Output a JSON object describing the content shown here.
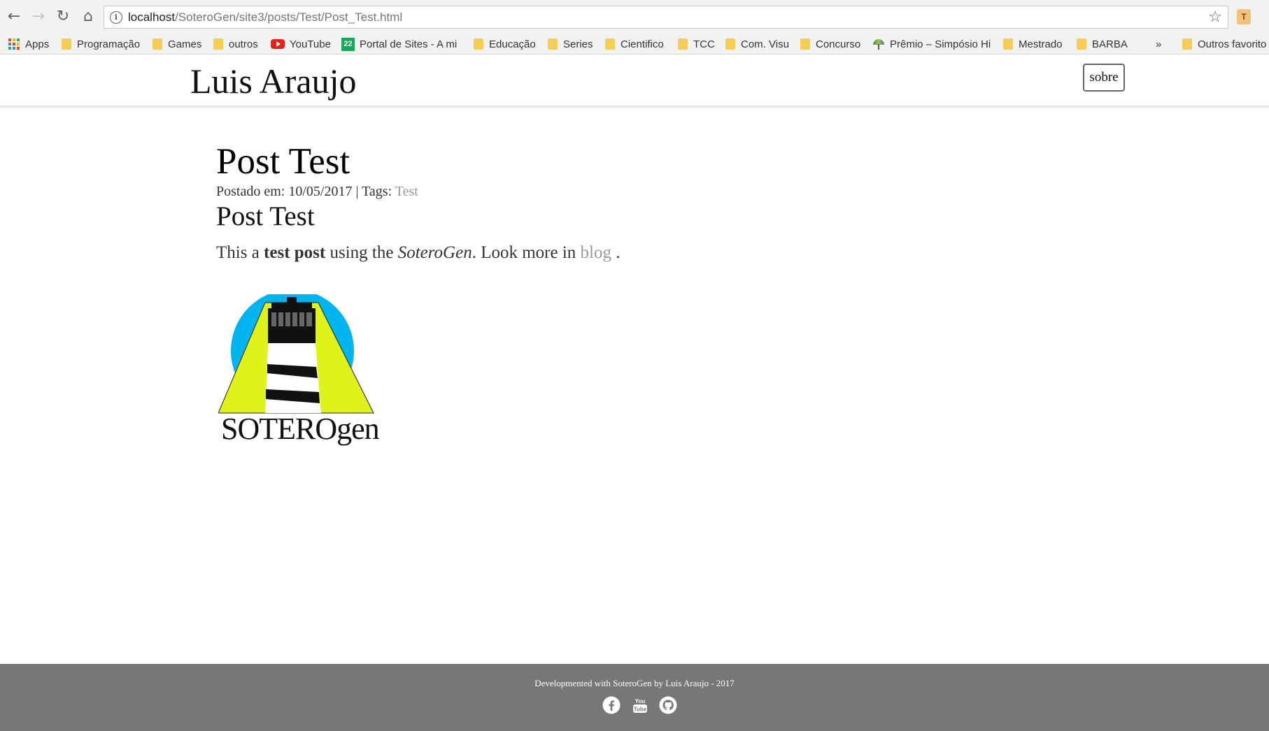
{
  "browser": {
    "url_host": "localhost",
    "url_path": "/SoteroGen/site3/posts/Test/Post_Test.html",
    "bookmarks": {
      "apps": "Apps",
      "programacao": "Programação",
      "games": "Games",
      "outros": "outros",
      "youtube": "YouTube",
      "portal": "Portal de Sites - A mi",
      "educacao": "Educação",
      "series": "Series",
      "cientifico": "Cientifico",
      "tcc": "TCC",
      "comvisu": "Com. Visu",
      "concurso": "Concurso",
      "premio": "Prêmio – Simpósio Hi",
      "mestrado": "Mestrado",
      "barba": "BARBA",
      "overflow": "»",
      "outros_favoritos": "Outros favorito"
    },
    "icons": {
      "back": "arrow-left",
      "forward": "arrow-right",
      "reload": "reload",
      "home": "home",
      "info": "info",
      "star": "star"
    }
  },
  "site": {
    "title": "Luis Araujo",
    "nav_sobre": "sobre"
  },
  "post": {
    "title": "Post Test",
    "meta_prefix": "Postado em: 10/05/2017 | Tags: ",
    "tag": "Test",
    "heading": "Post Test",
    "para_1": "This a ",
    "para_bold": "test post",
    "para_2": " using the ",
    "para_italic": "SoteroGen",
    "para_3": ". Look more in ",
    "para_link": "blog",
    "para_4": " ."
  },
  "logo": {
    "text_main": "SOTERO",
    "text_small": "gen",
    "colors": {
      "sky": "#00b4ef",
      "beam": "#dff219",
      "tower": "#111111"
    }
  },
  "footer": {
    "text": "Developmented with SoteroGen by Luis Araujo - 2017",
    "icons": [
      "facebook-icon",
      "youtube-icon",
      "github-icon"
    ]
  }
}
